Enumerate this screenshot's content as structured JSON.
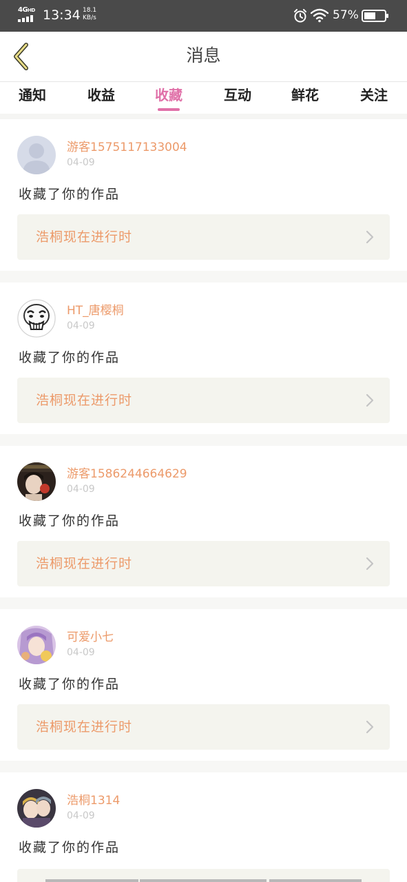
{
  "status_bar": {
    "network": "4G",
    "network_sub": "HD",
    "time": "13:34",
    "net_speed_value": "18.1",
    "net_speed_unit": "KB/s",
    "battery_percent": "57%",
    "battery_level": 0.57
  },
  "header": {
    "title": "消息",
    "back_icon": "chevron-left-icon"
  },
  "tabs": [
    {
      "label": "通知",
      "active": false
    },
    {
      "label": "收益",
      "active": false
    },
    {
      "label": "收藏",
      "active": true
    },
    {
      "label": "互动",
      "active": false
    },
    {
      "label": "鲜花",
      "active": false
    },
    {
      "label": "关注",
      "active": false
    }
  ],
  "messages": [
    {
      "username": "游客1575117133004",
      "date": "04-09",
      "text": "收藏了你的作品",
      "work_title": "浩桐现在进行时",
      "avatar": "default-avatar"
    },
    {
      "username": "HT_唐樱桐",
      "date": "04-09",
      "text": "收藏了你的作品",
      "work_title": "浩桐现在进行时",
      "avatar": "meme-face-avatar"
    },
    {
      "username": "游客1586244664629",
      "date": "04-09",
      "text": "收藏了你的作品",
      "work_title": "浩桐现在进行时",
      "avatar": "photo-avatar"
    },
    {
      "username": "可爱小七",
      "date": "04-09",
      "text": "收藏了你的作品",
      "work_title": "浩桐现在进行时",
      "avatar": "anime-avatar"
    },
    {
      "username": "浩桐1314",
      "date": "04-09",
      "text": "收藏了你的作品",
      "work_title": "",
      "avatar": "anime-pair-avatar"
    }
  ],
  "colors": {
    "accent": "#e070a8",
    "username": "#ec9a6a",
    "status_bar": "#4a4a4a",
    "card_link_bg": "#f4f4ee"
  }
}
